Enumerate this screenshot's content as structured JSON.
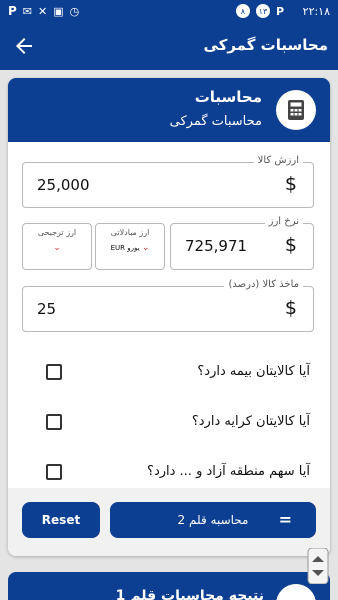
{
  "status_bar": {
    "time": "۲۲:۱۸",
    "notif_count": "۱۳",
    "notif_count2": "۸"
  },
  "app_bar": {
    "title": "محاسبات گمرکی"
  },
  "calc_card": {
    "title": "محاسبات",
    "subtitle": "محاسبات گمرکی",
    "goods_value": {
      "label": "ارزش کالا",
      "value": "25,000"
    },
    "exchange_rate": {
      "label": "نرخ ارز",
      "value": "725,971"
    },
    "exchange_currency": {
      "label": "ارز مبادلاتی",
      "value": "یورو EUR"
    },
    "preferred_currency": {
      "label": "ارز ترجیحی",
      "value": ""
    },
    "goods_source": {
      "label": "ماخذ کالا (درصد)",
      "value": "25"
    },
    "questions": [
      "آیا کالایتان بیمه دارد؟",
      "آیا کالایتان کرایه دارد؟",
      "آیا سهم منطقه آزاد و ... دارد؟"
    ],
    "reset_label": "Reset",
    "calc_label": "محاسبه قلم 2",
    "equals_symbol": "="
  },
  "next_card": {
    "title": "نتیجه محاسبات قلم 1"
  },
  "colors": {
    "primary": "#0c3f92",
    "chevron": "#dd3333"
  }
}
